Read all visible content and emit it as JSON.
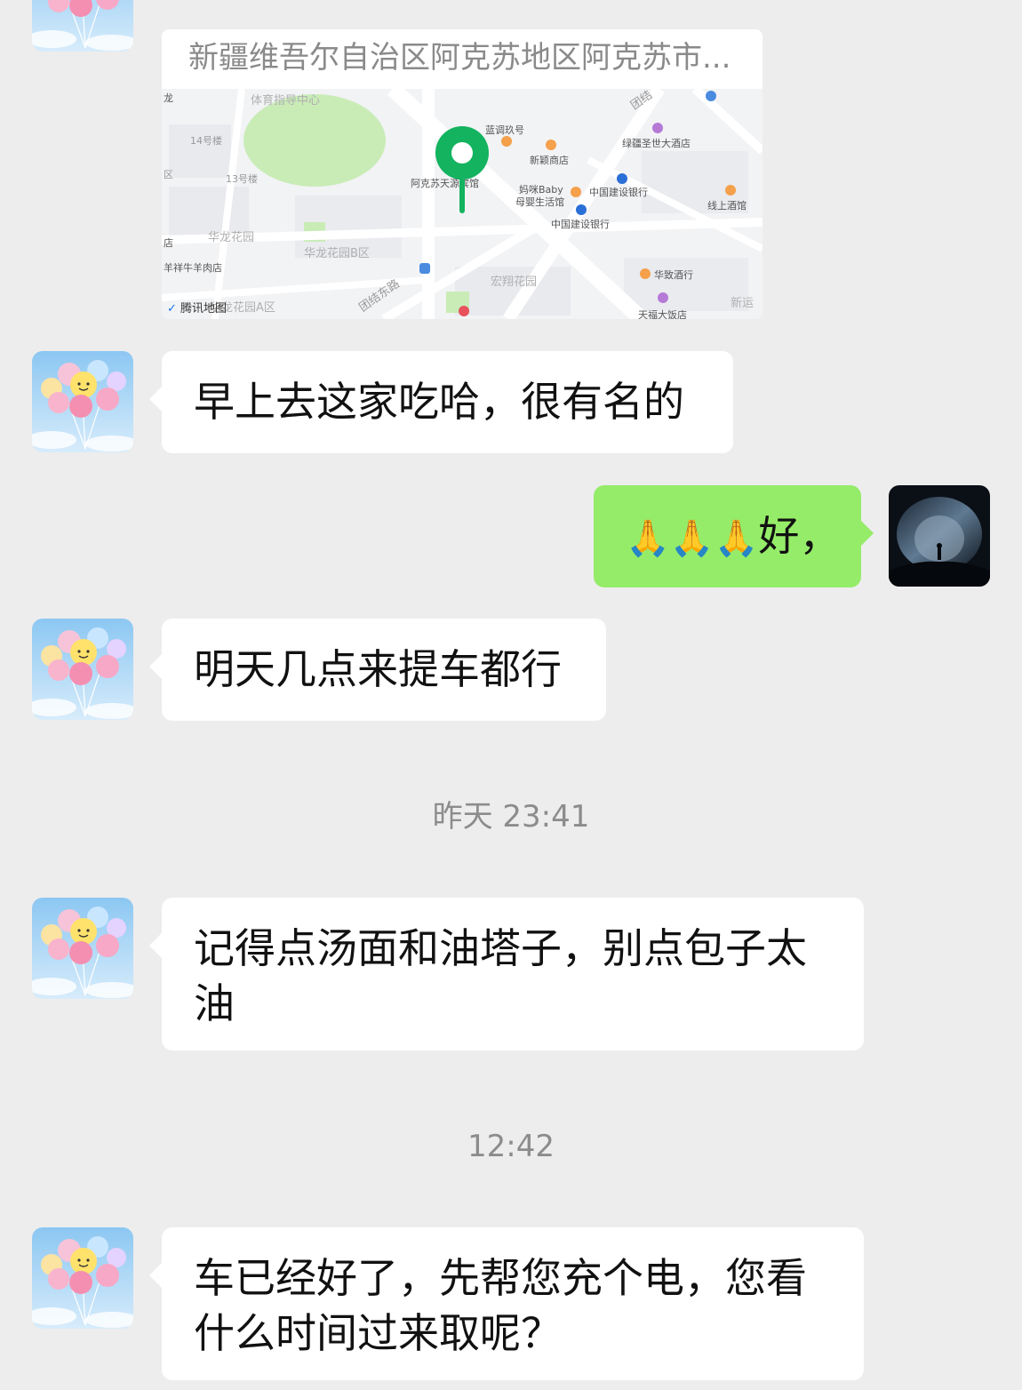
{
  "location_card": {
    "address": "新疆维吾尔自治区阿克苏地区阿克苏市...",
    "map": {
      "provider_label": "腾讯地图",
      "labels": {
        "sports_center": "体育指导中心",
        "bldg14": "14号楼",
        "bldg13": "13号楼",
        "hualong_garden": "华龙花园",
        "hualong_b": "华龙花园B区",
        "hualong_a": "华龙花园A区",
        "yangyang": "羊祥牛羊肉店",
        "hotel_pin": "阿克苏天源宾馆",
        "lantiao": "蓝调玖号",
        "xinying": "新颖商店",
        "mami": "妈咪Baby",
        "mami2": "母婴生活馆",
        "ccb1": "中国建设银行",
        "ccb2": "中国建设银行",
        "lvjiang": "绿疆圣世大酒店",
        "xianshang": "线上酒馆",
        "huazhi": "华致酒行",
        "tianfu": "天福大饭店",
        "hongxiang": "宏翔花园",
        "tuanjie_east": "团结东路",
        "tuanjie": "团结",
        "xinyun": "新运",
        "long": "龙",
        "qu": "区",
        "dian": "店"
      }
    }
  },
  "messages": [
    {
      "side": "left",
      "text": "早上去这家吃哈，很有名的"
    },
    {
      "side": "right",
      "emoji": "🙏🙏🙏",
      "text": "好，"
    },
    {
      "side": "left",
      "text": "明天几点来提车都行"
    },
    {
      "side": "left",
      "text": "记得点汤面和油塔子，别点包子太油"
    },
    {
      "side": "left",
      "text": "车已经好了，先帮您充个电，您看什么时间过来取呢？"
    }
  ],
  "timestamps": [
    "昨天 23:41",
    "12:42"
  ],
  "icons": {
    "sender_avatar": "balloon-avatar",
    "self_avatar": "cave-silhouette-avatar",
    "map_pin": "location-pin-icon",
    "emoji": "praying-hands-icon"
  },
  "colors": {
    "background": "#ededed",
    "bubble_left": "#ffffff",
    "bubble_right": "#95ec69",
    "pin": "#13b35f",
    "timestamp": "#8c8c8c"
  }
}
